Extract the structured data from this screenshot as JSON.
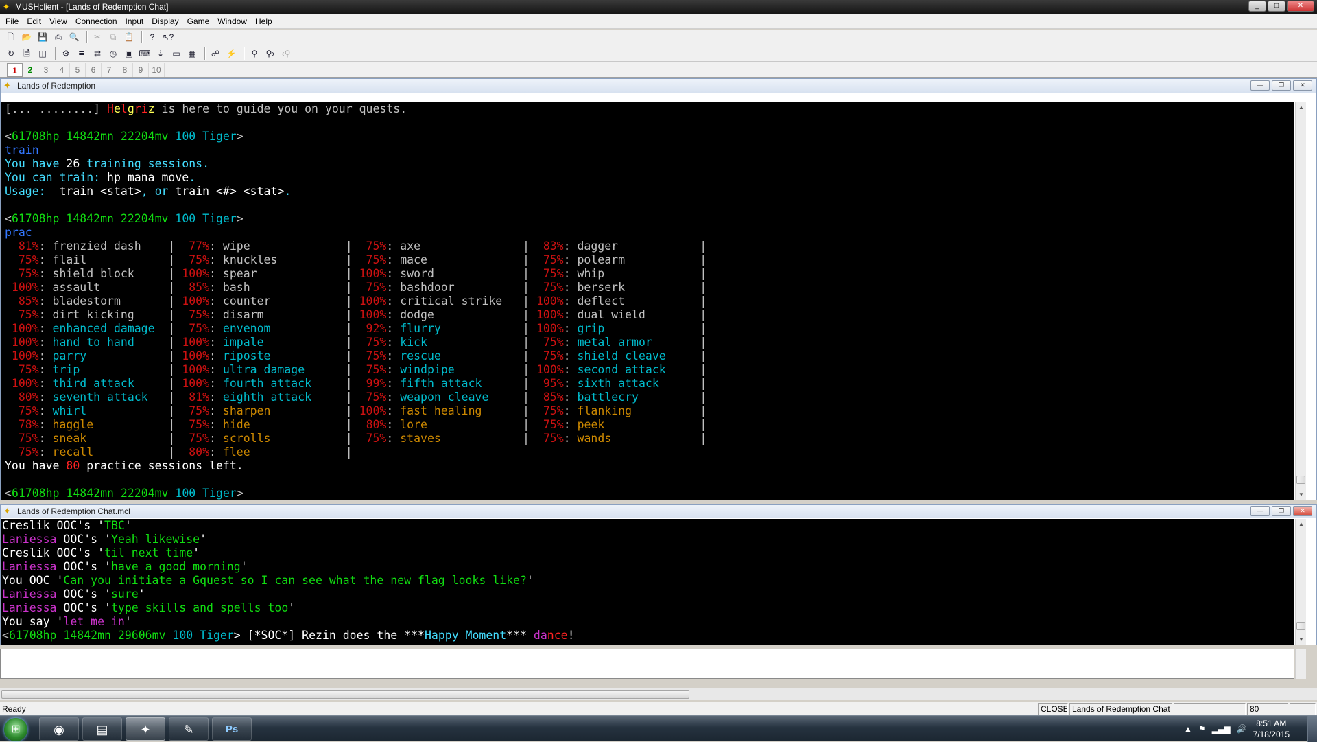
{
  "window": {
    "title": "MUSHclient - [Lands of Redemption Chat]",
    "btn_min": "_",
    "btn_max": "□",
    "btn_close": "✕"
  },
  "menu": [
    "File",
    "Edit",
    "View",
    "Connection",
    "Input",
    "Display",
    "Game",
    "Window",
    "Help"
  ],
  "toolbar1": [
    "new-icon",
    "open-icon",
    "save-icon",
    "print-icon",
    "print-preview-icon",
    "|",
    "cut-icon",
    "copy-icon",
    "paste-icon",
    "|",
    "help-icon",
    "context-help-icon"
  ],
  "toolbar2": [
    "refresh-icon",
    "notes-icon",
    "log-icon",
    "|",
    "world-config-icon",
    "triggers-icon",
    "aliases-icon",
    "timers-icon",
    "output-icon",
    "input-icon",
    "macro-icon",
    "|",
    "world-list-icon",
    "world-info-icon",
    "|",
    "connect-icon",
    "disconnect-icon",
    "|",
    "find-icon",
    "find-next-icon",
    "find-prev-icon"
  ],
  "window_tabs": [
    "1",
    "2",
    "3",
    "4",
    "5",
    "6",
    "7",
    "8",
    "9",
    "10"
  ],
  "main_world": {
    "title": "Lands of Redemption",
    "lines": [
      [
        [
          "[... ........] ",
          "gray"
        ],
        [
          "H",
          "r"
        ],
        [
          "e",
          "y"
        ],
        [
          "l",
          "r"
        ],
        [
          "g",
          "y"
        ],
        [
          "r",
          "r"
        ],
        [
          "i",
          "r"
        ],
        [
          "z",
          "y"
        ],
        [
          " is here to guide you on your quests.",
          "gray"
        ]
      ],
      [
        [
          "",
          ""
        ]
      ],
      [
        [
          "<",
          "gray"
        ],
        [
          "61708hp ",
          "g"
        ],
        [
          "14842mn ",
          "g"
        ],
        [
          "22204mv ",
          "g"
        ],
        [
          "100 Tiger",
          "c"
        ],
        [
          ">",
          "gray"
        ]
      ],
      [
        [
          "train",
          "b"
        ]
      ],
      [
        [
          "You have ",
          "cb"
        ],
        [
          "26",
          "w"
        ],
        [
          " training sessions.",
          "cb"
        ]
      ],
      [
        [
          "You can train: ",
          "cb"
        ],
        [
          "hp mana move",
          "w"
        ],
        [
          ".",
          "cb"
        ]
      ],
      [
        [
          "Usage:  ",
          "cb"
        ],
        [
          "train <stat>",
          "w"
        ],
        [
          ", or ",
          "cb"
        ],
        [
          "train <#> <stat>",
          "w"
        ],
        [
          ".",
          "cb"
        ]
      ],
      [
        [
          "",
          ""
        ]
      ],
      [
        [
          "<",
          "gray"
        ],
        [
          "61708hp ",
          "g"
        ],
        [
          "14842mn ",
          "g"
        ],
        [
          "22204mv ",
          "g"
        ],
        [
          "100 Tiger",
          "c"
        ],
        [
          ">",
          "gray"
        ]
      ],
      [
        [
          "prac",
          "b"
        ]
      ],
      [
        [
          "  81%",
          "dr"
        ],
        [
          ": frenzied dash    |  ",
          "gray"
        ],
        [
          "77%",
          "dr"
        ],
        [
          ": wipe              |  ",
          "gray"
        ],
        [
          "75%",
          "dr"
        ],
        [
          ": axe               |  ",
          "gray"
        ],
        [
          "83%",
          "dr"
        ],
        [
          ": dagger            |",
          "gray"
        ]
      ],
      [
        [
          "  75%",
          "dr"
        ],
        [
          ": flail            |  ",
          "gray"
        ],
        [
          "75%",
          "dr"
        ],
        [
          ": knuckles          |  ",
          "gray"
        ],
        [
          "75%",
          "dr"
        ],
        [
          ": mace              |  ",
          "gray"
        ],
        [
          "75%",
          "dr"
        ],
        [
          ": polearm           |",
          "gray"
        ]
      ],
      [
        [
          "  75%",
          "dr"
        ],
        [
          ": shield block     | ",
          "gray"
        ],
        [
          "100%",
          "dr"
        ],
        [
          ": spear             | ",
          "gray"
        ],
        [
          "100%",
          "dr"
        ],
        [
          ": sword             |  ",
          "gray"
        ],
        [
          "75%",
          "dr"
        ],
        [
          ": whip              |",
          "gray"
        ]
      ],
      [
        [
          " 100%",
          "dr"
        ],
        [
          ": assault          |  ",
          "gray"
        ],
        [
          "85%",
          "dr"
        ],
        [
          ": bash              |  ",
          "gray"
        ],
        [
          "75%",
          "dr"
        ],
        [
          ": bashdoor          |  ",
          "gray"
        ],
        [
          "75%",
          "dr"
        ],
        [
          ": berserk           |",
          "gray"
        ]
      ],
      [
        [
          "  85%",
          "dr"
        ],
        [
          ": bladestorm       | ",
          "gray"
        ],
        [
          "100%",
          "dr"
        ],
        [
          ": counter           | ",
          "gray"
        ],
        [
          "100%",
          "dr"
        ],
        [
          ": critical strike   | ",
          "gray"
        ],
        [
          "100%",
          "dr"
        ],
        [
          ": deflect           |",
          "gray"
        ]
      ],
      [
        [
          "  75%",
          "dr"
        ],
        [
          ": dirt kicking     |  ",
          "gray"
        ],
        [
          "75%",
          "dr"
        ],
        [
          ": disarm            | ",
          "gray"
        ],
        [
          "100%",
          "dr"
        ],
        [
          ": dodge             | ",
          "gray"
        ],
        [
          "100%",
          "dr"
        ],
        [
          ": dual wield        |",
          "gray"
        ]
      ],
      [
        [
          " 100%",
          "dr"
        ],
        [
          ": ",
          "gray"
        ],
        [
          "enhanced damage",
          "c"
        ],
        [
          "  |  ",
          "gray"
        ],
        [
          "75%",
          "dr"
        ],
        [
          ": ",
          "gray"
        ],
        [
          "envenom",
          "c"
        ],
        [
          "           |  ",
          "gray"
        ],
        [
          "92%",
          "dr"
        ],
        [
          ": ",
          "gray"
        ],
        [
          "flurry",
          "c"
        ],
        [
          "            | ",
          "gray"
        ],
        [
          "100%",
          "dr"
        ],
        [
          ": ",
          "gray"
        ],
        [
          "grip",
          "c"
        ],
        [
          "              |",
          "gray"
        ]
      ],
      [
        [
          " 100%",
          "dr"
        ],
        [
          ": ",
          "gray"
        ],
        [
          "hand to hand",
          "c"
        ],
        [
          "     | ",
          "gray"
        ],
        [
          "100%",
          "dr"
        ],
        [
          ": ",
          "gray"
        ],
        [
          "impale",
          "c"
        ],
        [
          "            |  ",
          "gray"
        ],
        [
          "75%",
          "dr"
        ],
        [
          ": ",
          "gray"
        ],
        [
          "kick",
          "c"
        ],
        [
          "              |  ",
          "gray"
        ],
        [
          "75%",
          "dr"
        ],
        [
          ": ",
          "gray"
        ],
        [
          "metal armor",
          "c"
        ],
        [
          "       |",
          "gray"
        ]
      ],
      [
        [
          " 100%",
          "dr"
        ],
        [
          ": ",
          "gray"
        ],
        [
          "parry",
          "c"
        ],
        [
          "            | ",
          "gray"
        ],
        [
          "100%",
          "dr"
        ],
        [
          ": ",
          "gray"
        ],
        [
          "riposte",
          "c"
        ],
        [
          "           |  ",
          "gray"
        ],
        [
          "75%",
          "dr"
        ],
        [
          ": ",
          "gray"
        ],
        [
          "rescue",
          "c"
        ],
        [
          "            |  ",
          "gray"
        ],
        [
          "75%",
          "dr"
        ],
        [
          ": ",
          "gray"
        ],
        [
          "shield cleave",
          "c"
        ],
        [
          "     |",
          "gray"
        ]
      ],
      [
        [
          "  75%",
          "dr"
        ],
        [
          ": ",
          "gray"
        ],
        [
          "trip",
          "c"
        ],
        [
          "             | ",
          "gray"
        ],
        [
          "100%",
          "dr"
        ],
        [
          ": ",
          "gray"
        ],
        [
          "ultra damage",
          "c"
        ],
        [
          "      |  ",
          "gray"
        ],
        [
          "75%",
          "dr"
        ],
        [
          ": ",
          "gray"
        ],
        [
          "windpipe",
          "c"
        ],
        [
          "          | ",
          "gray"
        ],
        [
          "100%",
          "dr"
        ],
        [
          ": ",
          "gray"
        ],
        [
          "second attack",
          "c"
        ],
        [
          "     |",
          "gray"
        ]
      ],
      [
        [
          " 100%",
          "dr"
        ],
        [
          ": ",
          "gray"
        ],
        [
          "third attack",
          "c"
        ],
        [
          "     | ",
          "gray"
        ],
        [
          "100%",
          "dr"
        ],
        [
          ": ",
          "gray"
        ],
        [
          "fourth attack",
          "c"
        ],
        [
          "     |  ",
          "gray"
        ],
        [
          "99%",
          "dr"
        ],
        [
          ": ",
          "gray"
        ],
        [
          "fifth attack",
          "c"
        ],
        [
          "      |  ",
          "gray"
        ],
        [
          "95%",
          "dr"
        ],
        [
          ": ",
          "gray"
        ],
        [
          "sixth attack",
          "c"
        ],
        [
          "      |",
          "gray"
        ]
      ],
      [
        [
          "  80%",
          "dr"
        ],
        [
          ": ",
          "gray"
        ],
        [
          "seventh attack",
          "c"
        ],
        [
          "   |  ",
          "gray"
        ],
        [
          "81%",
          "dr"
        ],
        [
          ": ",
          "gray"
        ],
        [
          "eighth attack",
          "c"
        ],
        [
          "     |  ",
          "gray"
        ],
        [
          "75%",
          "dr"
        ],
        [
          ": ",
          "gray"
        ],
        [
          "weapon cleave",
          "c"
        ],
        [
          "     |  ",
          "gray"
        ],
        [
          "85%",
          "dr"
        ],
        [
          ": ",
          "gray"
        ],
        [
          "battlecry",
          "c"
        ],
        [
          "         |",
          "gray"
        ]
      ],
      [
        [
          "  75%",
          "dr"
        ],
        [
          ": ",
          "gray"
        ],
        [
          "whirl",
          "c"
        ],
        [
          "            |  ",
          "gray"
        ],
        [
          "75%",
          "dr"
        ],
        [
          ": ",
          "gray"
        ],
        [
          "sharpen",
          "o"
        ],
        [
          "           | ",
          "gray"
        ],
        [
          "100%",
          "dr"
        ],
        [
          ": ",
          "gray"
        ],
        [
          "fast healing",
          "o"
        ],
        [
          "      |  ",
          "gray"
        ],
        [
          "75%",
          "dr"
        ],
        [
          ": ",
          "gray"
        ],
        [
          "flanking",
          "o"
        ],
        [
          "          |",
          "gray"
        ]
      ],
      [
        [
          "  78%",
          "dr"
        ],
        [
          ": ",
          "gray"
        ],
        [
          "haggle",
          "o"
        ],
        [
          "           |  ",
          "gray"
        ],
        [
          "75%",
          "dr"
        ],
        [
          ": ",
          "gray"
        ],
        [
          "hide",
          "o"
        ],
        [
          "              |  ",
          "gray"
        ],
        [
          "80%",
          "dr"
        ],
        [
          ": ",
          "gray"
        ],
        [
          "lore",
          "o"
        ],
        [
          "              |  ",
          "gray"
        ],
        [
          "75%",
          "dr"
        ],
        [
          ": ",
          "gray"
        ],
        [
          "peek",
          "o"
        ],
        [
          "              |",
          "gray"
        ]
      ],
      [
        [
          "  75%",
          "dr"
        ],
        [
          ": ",
          "gray"
        ],
        [
          "sneak",
          "o"
        ],
        [
          "            |  ",
          "gray"
        ],
        [
          "75%",
          "dr"
        ],
        [
          ": ",
          "gray"
        ],
        [
          "scrolls",
          "o"
        ],
        [
          "           |  ",
          "gray"
        ],
        [
          "75%",
          "dr"
        ],
        [
          ": ",
          "gray"
        ],
        [
          "staves",
          "o"
        ],
        [
          "            |  ",
          "gray"
        ],
        [
          "75%",
          "dr"
        ],
        [
          ": ",
          "gray"
        ],
        [
          "wands",
          "o"
        ],
        [
          "             |",
          "gray"
        ]
      ],
      [
        [
          "  75%",
          "dr"
        ],
        [
          ": ",
          "gray"
        ],
        [
          "recall",
          "o"
        ],
        [
          "           |  ",
          "gray"
        ],
        [
          "80%",
          "dr"
        ],
        [
          ": ",
          "gray"
        ],
        [
          "flee",
          "o"
        ],
        [
          "              |",
          "gray"
        ]
      ],
      [
        [
          "You have ",
          "w"
        ],
        [
          "80",
          "r"
        ],
        [
          " practice sessions left.",
          "w"
        ]
      ],
      [
        [
          "",
          ""
        ]
      ],
      [
        [
          "<",
          "gray"
        ],
        [
          "61708hp ",
          "g"
        ],
        [
          "14842mn ",
          "g"
        ],
        [
          "22204mv ",
          "g"
        ],
        [
          "100 Tiger",
          "c"
        ],
        [
          ">",
          "gray"
        ]
      ]
    ]
  },
  "chat_world": {
    "title": "Lands of Redemption Chat.mcl",
    "lines": [
      [
        [
          "Creslik OOC's '",
          "w"
        ],
        [
          "TBC",
          "g"
        ],
        [
          "'",
          "w"
        ]
      ],
      [
        [
          "Laniessa",
          "m"
        ],
        [
          " OOC's '",
          "w"
        ],
        [
          "Yeah likewise",
          "g"
        ],
        [
          "'",
          "w"
        ]
      ],
      [
        [
          "Creslik OOC's '",
          "w"
        ],
        [
          "til next time",
          "g"
        ],
        [
          "'",
          "w"
        ]
      ],
      [
        [
          "Laniessa",
          "m"
        ],
        [
          " OOC's '",
          "w"
        ],
        [
          "have a good morning",
          "g"
        ],
        [
          "'",
          "w"
        ]
      ],
      [
        [
          "You OOC '",
          "w"
        ],
        [
          "Can you initiate a Gquest so I can see what the new flag looks like?",
          "g"
        ],
        [
          "'",
          "w"
        ]
      ],
      [
        [
          "Laniessa",
          "m"
        ],
        [
          " OOC's '",
          "w"
        ],
        [
          "sure",
          "g"
        ],
        [
          "'",
          "w"
        ]
      ],
      [
        [
          "Laniessa",
          "m"
        ],
        [
          " OOC's '",
          "w"
        ],
        [
          "type skills and spells too",
          "g"
        ],
        [
          "'",
          "w"
        ]
      ],
      [
        [
          "You say '",
          "w"
        ],
        [
          "let me in",
          "m"
        ],
        [
          "'",
          "w"
        ]
      ],
      [
        [
          "<",
          "gray"
        ],
        [
          "61708hp ",
          "g"
        ],
        [
          "14842mn ",
          "g"
        ],
        [
          "29606mv ",
          "g"
        ],
        [
          "100 Tiger",
          "c"
        ],
        [
          "> [*SOC*] Rezin does the ***",
          "w"
        ],
        [
          "Happy Moment",
          "cb"
        ],
        [
          "*** ",
          "w"
        ],
        [
          "da",
          "m"
        ],
        [
          "nce",
          "r"
        ],
        [
          "!",
          "w"
        ]
      ]
    ]
  },
  "command_input": {
    "value": ""
  },
  "statusbar": {
    "ready": "Ready",
    "state": "CLOSED",
    "world": "Lands of Redemption Chat",
    "cols": "80"
  },
  "taskbar": {
    "apps": [
      {
        "name": "firefox",
        "glyph": "◉"
      },
      {
        "name": "explorer",
        "glyph": "▤"
      },
      {
        "name": "mushclient",
        "glyph": "✦"
      },
      {
        "name": "notepad",
        "glyph": "✎"
      },
      {
        "name": "photoshop",
        "glyph": "Ps"
      }
    ],
    "time": "8:51 AM",
    "date": "7/18/2015"
  },
  "colors": {
    "r": "#ff2222",
    "y": "#ffff55",
    "g": "#11dd11",
    "c": "#00bbcc",
    "cb": "#44ddff",
    "w": "#ffffff",
    "gray": "#c0c0c0",
    "m": "#cc33cc",
    "dr": "#cc1111",
    "o": "#cc8800",
    "b": "#3377ff"
  }
}
